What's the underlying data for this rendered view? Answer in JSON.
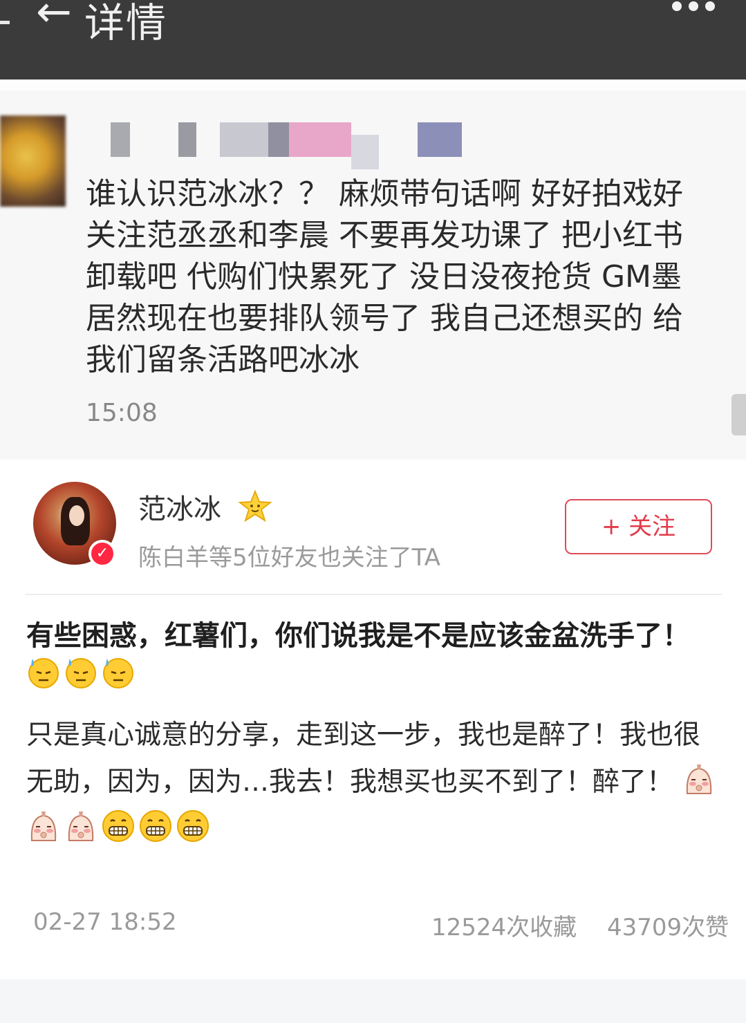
{
  "app_bar": {
    "back_icon": "←",
    "title": "详情",
    "more_icon": "more-dots-icon"
  },
  "screenshot": {
    "message_lines": [
      "谁认识范冰冰？？ 麻烦带句话啊 好好拍戏好",
      "关注范丞丞和李晨 不要再发功课了 把小红书",
      "卸载吧 代购们快累死了 没日没夜抢货 GM墨",
      "居然现在也要排队领号了 我自己还想买的 给",
      "我们留条活路吧冰冰"
    ],
    "time": "15:08"
  },
  "author": {
    "name": "范冰冰",
    "followers_note": "陈白羊等5位好友也关注了TA",
    "follow_label": "+ 关注",
    "verified_icon": "✓"
  },
  "post": {
    "title": "有些困惑，红薯们，你们说我是不是应该金盆洗手了！",
    "title_emojis": [
      "sweat-face-icon",
      "sweat-face-icon",
      "sweat-face-icon"
    ],
    "body_text": "只是真心诚意的分享，走到这一步，我也是醉了！我也很无助，因为，因为…我去！我想买也买不到了！醉了！",
    "body_emojis": [
      "shy-face-icon",
      "shy-face-icon",
      "shy-face-icon",
      "grin-face-icon",
      "grin-face-icon",
      "grin-face-icon"
    ]
  },
  "meta": {
    "date": "02-27 18:52",
    "favorites": "12524次收藏",
    "likes": "43709次赞"
  },
  "colors": {
    "accent": "#e23b4b",
    "app_bar": "#3b3b3b",
    "muted_text": "#9a9a9a"
  }
}
